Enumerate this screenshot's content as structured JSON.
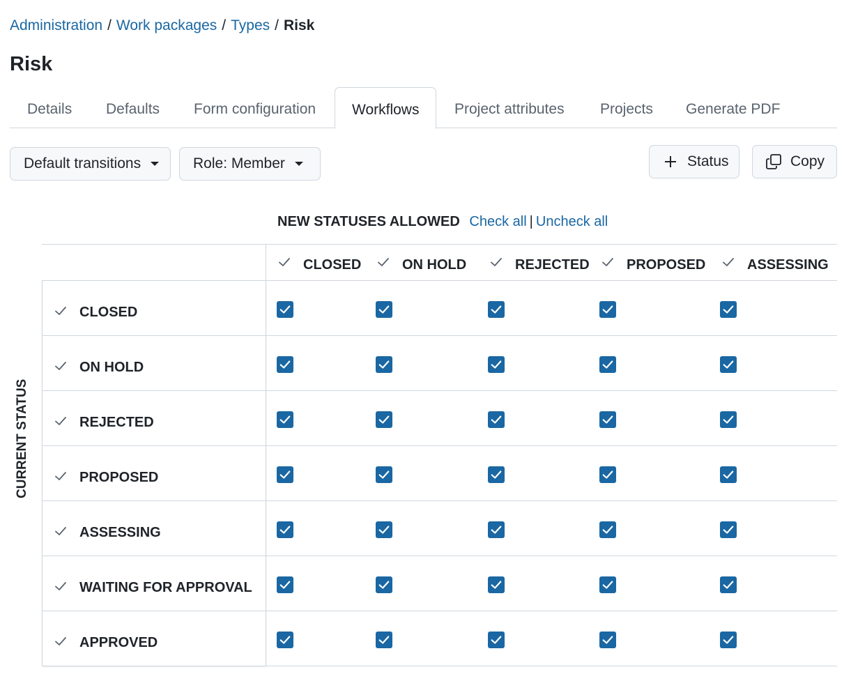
{
  "breadcrumb": {
    "items": [
      "Administration",
      "Work packages",
      "Types"
    ],
    "separator": "/",
    "current": "Risk"
  },
  "page_title": "Risk",
  "tabs": [
    {
      "label": "Details"
    },
    {
      "label": "Defaults"
    },
    {
      "label": "Form configuration"
    },
    {
      "label": "Workflows",
      "active": true
    },
    {
      "label": "Project attributes"
    },
    {
      "label": "Projects"
    },
    {
      "label": "Generate PDF"
    }
  ],
  "toolbar": {
    "transitions_select": "Default transitions",
    "role_select": "Role: Member",
    "status_button": "Status",
    "copy_button": "Copy"
  },
  "matrix": {
    "new_statuses_title": "NEW STATUSES ALLOWED",
    "check_all": "Check all",
    "uncheck_all": "Uncheck all",
    "separator": "|",
    "current_status_label": "CURRENT STATUS",
    "columns": [
      "CLOSED",
      "ON HOLD",
      "REJECTED",
      "PROPOSED",
      "ASSESSING"
    ],
    "rows": [
      {
        "label": "CLOSED",
        "checked": [
          true,
          true,
          true,
          true,
          true
        ]
      },
      {
        "label": "ON HOLD",
        "checked": [
          true,
          true,
          true,
          true,
          true
        ]
      },
      {
        "label": "REJECTED",
        "checked": [
          true,
          true,
          true,
          true,
          true
        ]
      },
      {
        "label": "PROPOSED",
        "checked": [
          true,
          true,
          true,
          true,
          true
        ]
      },
      {
        "label": "ASSESSING",
        "checked": [
          true,
          true,
          true,
          true,
          true
        ]
      },
      {
        "label": "WAITING FOR APPROVAL",
        "checked": [
          true,
          true,
          true,
          true,
          true
        ]
      },
      {
        "label": "APPROVED",
        "checked": [
          true,
          true,
          true,
          true,
          true
        ]
      }
    ]
  },
  "colors": {
    "link": "#1a67a3",
    "checkbox": "#1a67a3",
    "border": "#d0d7de",
    "button_bg": "#f6f8fa"
  },
  "icons": {
    "status_button": "plus-icon",
    "copy_button": "copy-icon",
    "column_marker": "check-icon",
    "row_marker": "check-icon",
    "select_caret": "triangle-down-icon"
  }
}
